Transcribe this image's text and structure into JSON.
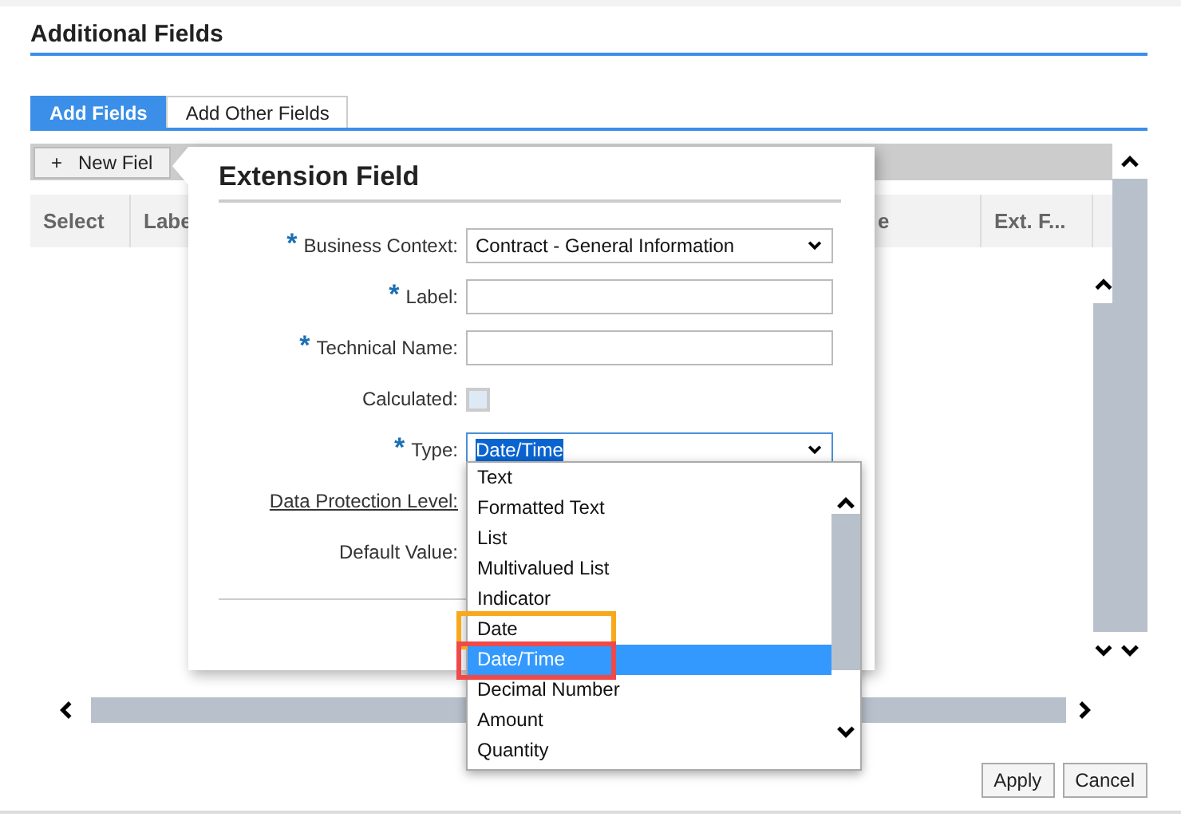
{
  "window": {
    "title": "Additional Fields"
  },
  "tabs": [
    {
      "label": "Add Fields",
      "selected": true
    },
    {
      "label": "Add Other Fields",
      "selected": false
    }
  ],
  "toolbar": {
    "new_button": {
      "icon": "+",
      "label": "New Fiel"
    }
  },
  "table": {
    "columns": [
      "Select",
      "Labe",
      "e",
      "Ext. F..."
    ]
  },
  "popover": {
    "title": "Extension Field",
    "required_mark": "*",
    "fields": [
      {
        "kind": "select",
        "label": "Business Context:",
        "required": true,
        "value": "Contract - General Information",
        "focused": false
      },
      {
        "kind": "text",
        "label": "Label:",
        "required": true
      },
      {
        "kind": "text",
        "label": "Technical Name:",
        "required": true
      },
      {
        "kind": "checkbox",
        "label": "Calculated:",
        "required": false,
        "checked": false
      },
      {
        "kind": "select",
        "label": "Type:",
        "required": true,
        "value": "Date/Time",
        "focused": true
      },
      {
        "kind": "link",
        "label": "Data Protection Level:",
        "required": false
      },
      {
        "kind": "label",
        "label": "Default Value:",
        "required": false
      }
    ]
  },
  "dropdown": {
    "items": [
      {
        "label": "Text",
        "selected": false
      },
      {
        "label": "Formatted Text",
        "selected": false
      },
      {
        "label": "List",
        "selected": false
      },
      {
        "label": "Multivalued List",
        "selected": false
      },
      {
        "label": "Indicator",
        "selected": false
      },
      {
        "label": "Date",
        "selected": false,
        "color": "#f8a81c"
      },
      {
        "label": "Date/Time",
        "selected": true,
        "color": "#ef4a4a"
      },
      {
        "label": "Decimal Number",
        "selected": false
      },
      {
        "label": "Amount",
        "selected": false
      },
      {
        "label": "Quantity",
        "selected": false
      }
    ]
  },
  "footer_buttons": [
    "Apply",
    "Cancel"
  ]
}
